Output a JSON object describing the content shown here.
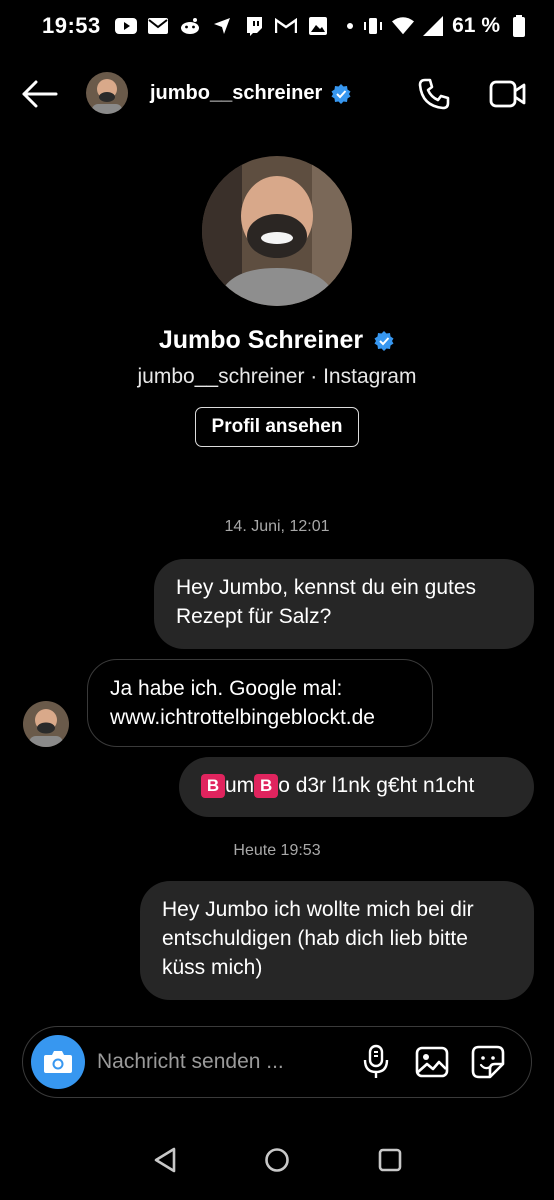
{
  "status_bar": {
    "time": "19:53",
    "battery": "61 %",
    "left_icons": [
      "youtube-icon",
      "mail-icon",
      "reddit-icon",
      "airplane-icon",
      "twitch-icon",
      "gmail-icon",
      "gallery-icon",
      "dot-icon"
    ],
    "right_icons": [
      "vibrate-icon",
      "wifi-icon",
      "signal-icon",
      "battery-icon"
    ]
  },
  "header": {
    "username": "jumbo__schreiner",
    "verified": true
  },
  "profile": {
    "name": "Jumbo Schreiner",
    "subtitle": "jumbo__schreiner · Instagram",
    "button_label": "Profil ansehen"
  },
  "messages": {
    "timestamp_1": "14. Juni, 12:01",
    "m1": {
      "direction": "out",
      "line1": "Hey Jumbo, kennst du ein gutes",
      "line2": "Rezept für Salz?"
    },
    "m2": {
      "direction": "in",
      "line1": "Ja habe ich. Google mal:",
      "line2": "www.ichtrottelbingeblockt.de"
    },
    "m3": {
      "direction": "out",
      "badge1": "B",
      "part1": "um",
      "badge2": "B",
      "part2": "o d3r l1nk g€ht n1cht"
    },
    "timestamp_2": "Heute 19:53",
    "m4": {
      "direction": "out",
      "line1": "Hey Jumbo ich wollte mich bei dir",
      "line2": "entschuldigen (hab dich lieb bitte",
      "line3": "küss mich)"
    }
  },
  "composer": {
    "placeholder": "Nachricht senden ...",
    "icons": [
      "camera-icon",
      "microphone-icon",
      "image-icon",
      "sticker-icon"
    ]
  },
  "colors": {
    "background": "#000000",
    "bubble_out": "#262626",
    "verified_blue": "#3797f0",
    "camera_blue": "#3797f0",
    "badge_red": "#e0245e"
  }
}
